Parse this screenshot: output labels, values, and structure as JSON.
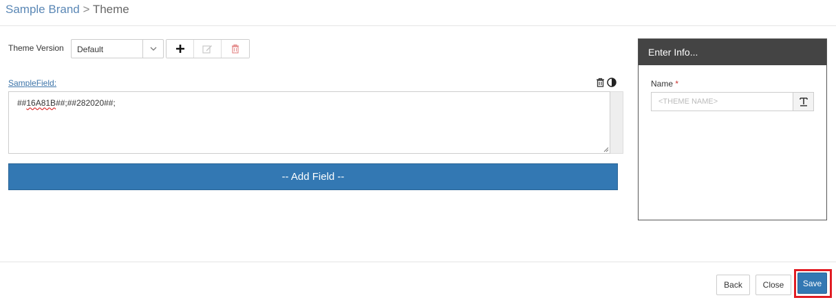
{
  "breadcrumb": {
    "parent": "Sample Brand",
    "separator": ">",
    "current": "Theme"
  },
  "theme_version": {
    "label": "Theme Version",
    "selected": "Default",
    "icons": [
      "plus-icon",
      "edit-icon",
      "trash-icon"
    ]
  },
  "field": {
    "label": "SampleField:",
    "value_part1": "##",
    "value_spell": "16A81B",
    "value_part2": "##;##282020##;",
    "icons": [
      "trash-icon",
      "contrast-icon"
    ]
  },
  "add_field": {
    "label": "-- Add Field --"
  },
  "info_panel": {
    "title": "Enter Info...",
    "name_label": "Name",
    "required_mark": "*",
    "name_placeholder": "<THEME NAME>",
    "addon_icon": "text-format-icon"
  },
  "footer": {
    "back": "Back",
    "close": "Close",
    "save": "Save"
  },
  "colors": {
    "primary": "#3378b3",
    "panel_header": "#444444",
    "highlight": "#e11b22",
    "link": "#3b73a8"
  }
}
